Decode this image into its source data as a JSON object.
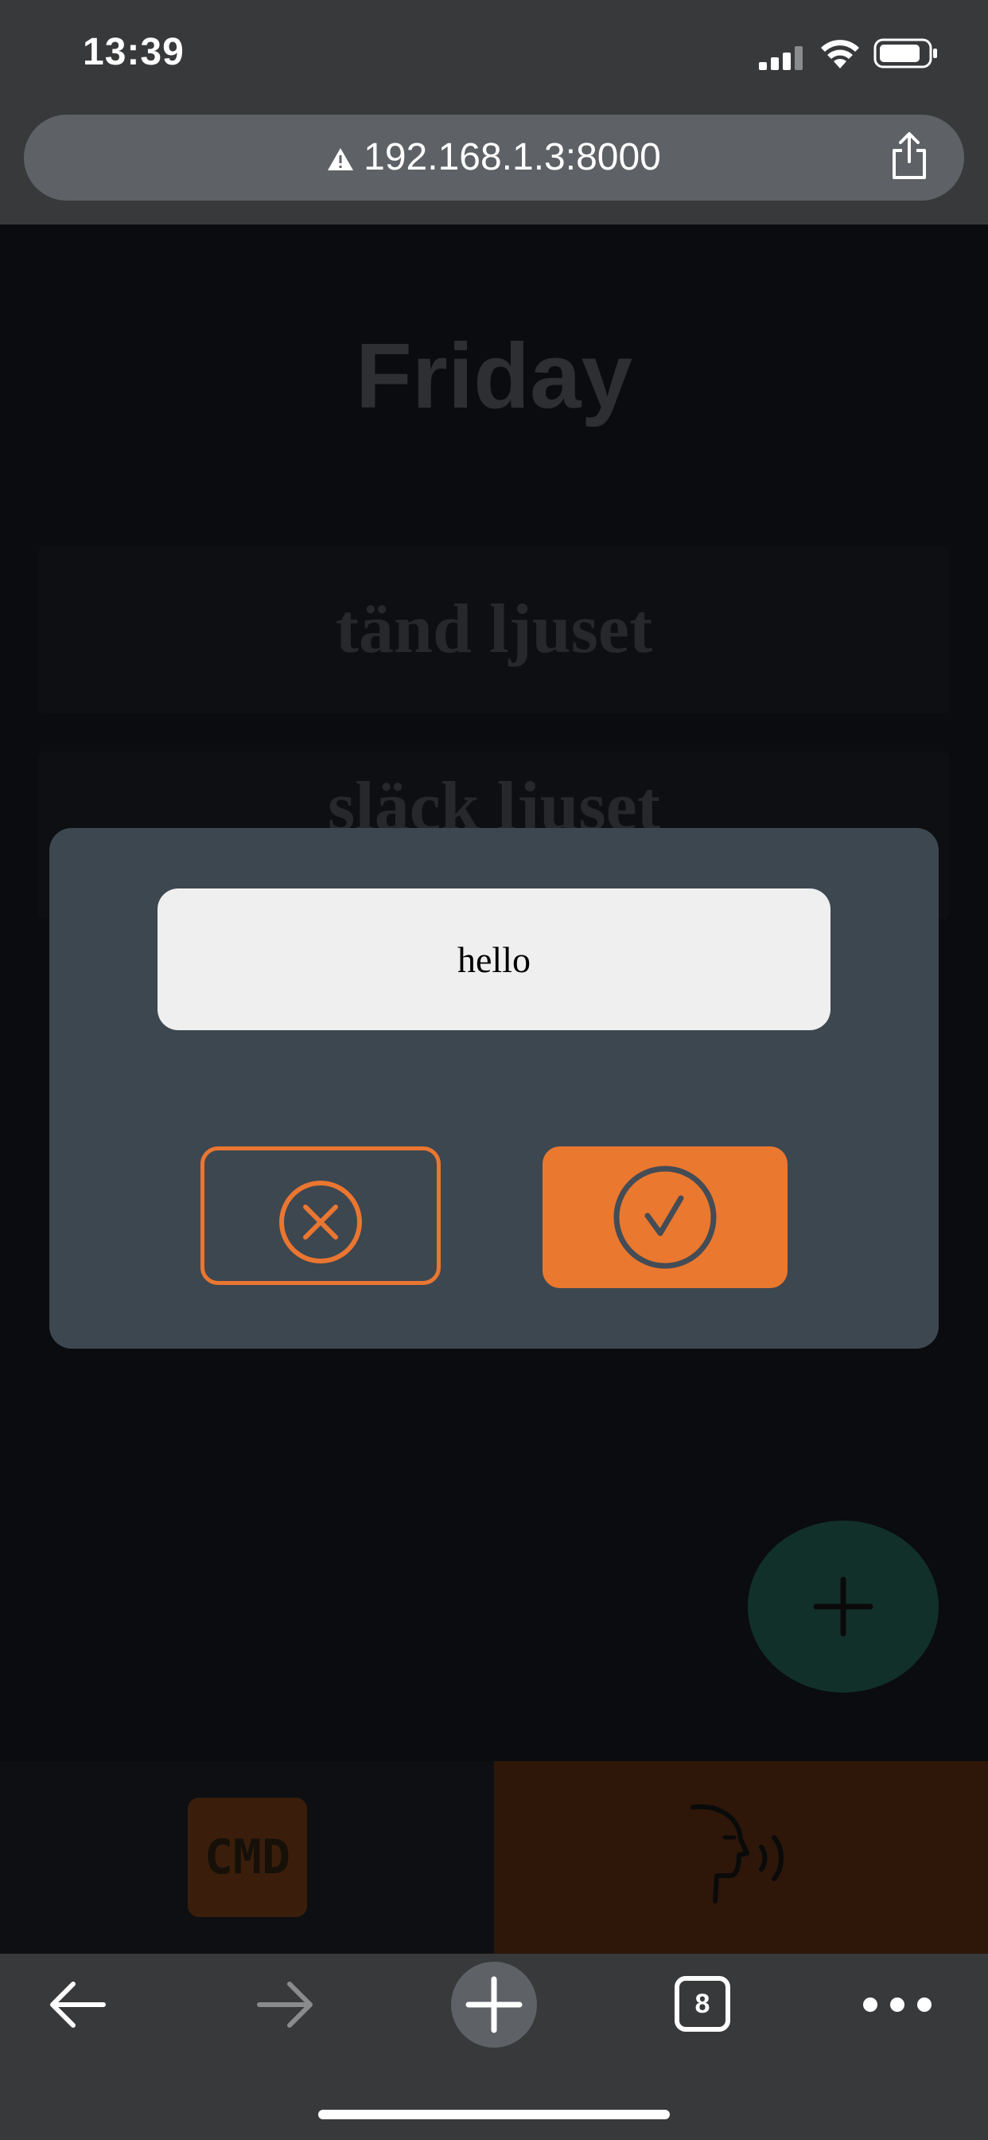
{
  "status_bar": {
    "time": "13:39"
  },
  "browser": {
    "url": "192.168.1.3:8000",
    "tab_count": "8"
  },
  "page": {
    "title": "Friday",
    "commands": [
      "tänd ljuset",
      "släck ljuset"
    ],
    "cmd_label": "CMD"
  },
  "dialog": {
    "input_value": "hello"
  },
  "colors": {
    "accent_orange": "#eb782f",
    "modal_bg": "#3d4750",
    "fab_green": "#12302a"
  },
  "icons": {
    "cancel": "x-circle-icon",
    "confirm": "check-circle-icon",
    "add": "plus-icon",
    "speak": "voice-face-icon"
  }
}
